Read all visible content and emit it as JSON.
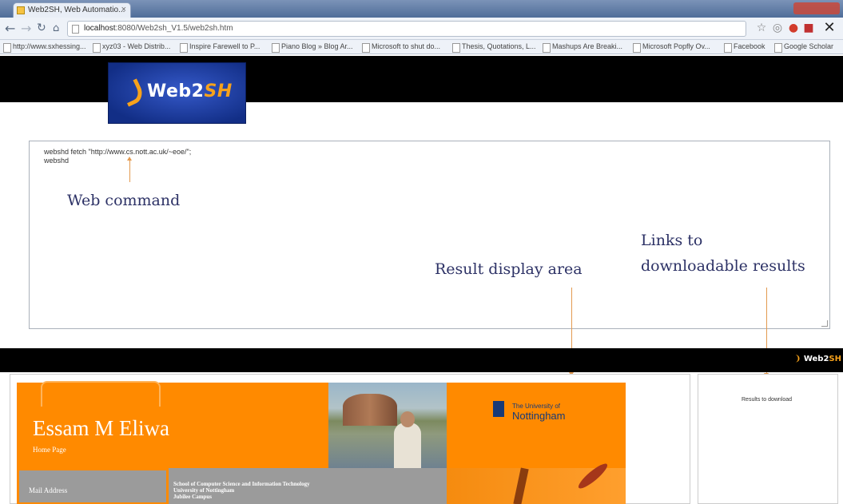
{
  "browser": {
    "tab_title": "Web2SH, Web Automatio...",
    "url_host": "localhost",
    "url_path": ":8080/Web2sh_V1.5/web2sh.htm",
    "bookmarks": [
      "http://www.sxhessing...",
      "xyz03 - Web Distrib...",
      "Inspire Farewell to P...",
      "Piano Blog » Blog Ar...",
      "Microsoft to shut do...",
      "Thesis, Quotations, L...",
      "Mashups Are Breaki...",
      "Microsoft Popfly Ov...",
      "Facebook",
      "Google Scholar"
    ]
  },
  "app": {
    "logo_main": "Web2",
    "logo_accent": "SH",
    "command_text": "webshd fetch \"http://www.cs.nott.ac.uk/~eoe/\";\nwebshd",
    "mini_logo_main": "Web2",
    "mini_logo_accent": "SH"
  },
  "annotations": {
    "web_command": "Web command",
    "result_display": "Result display area",
    "links_line1": "Links to",
    "links_line2": "downloadable results"
  },
  "result_page": {
    "name": "Essam M Eliwa",
    "home_page": "Home Page",
    "university_small": "The University of",
    "university_big": "Nottingham",
    "mail_address": "Mail Address",
    "school_text": "School of Computer Science and Information Technology\nUniversity of Nottingham\nJubilee Campus"
  },
  "download_pane": {
    "label": "Results to download"
  },
  "colors": {
    "accent_orange": "#ff8a00",
    "annotation_text": "#2d3266",
    "logo_blue": "#1a3ea8"
  }
}
